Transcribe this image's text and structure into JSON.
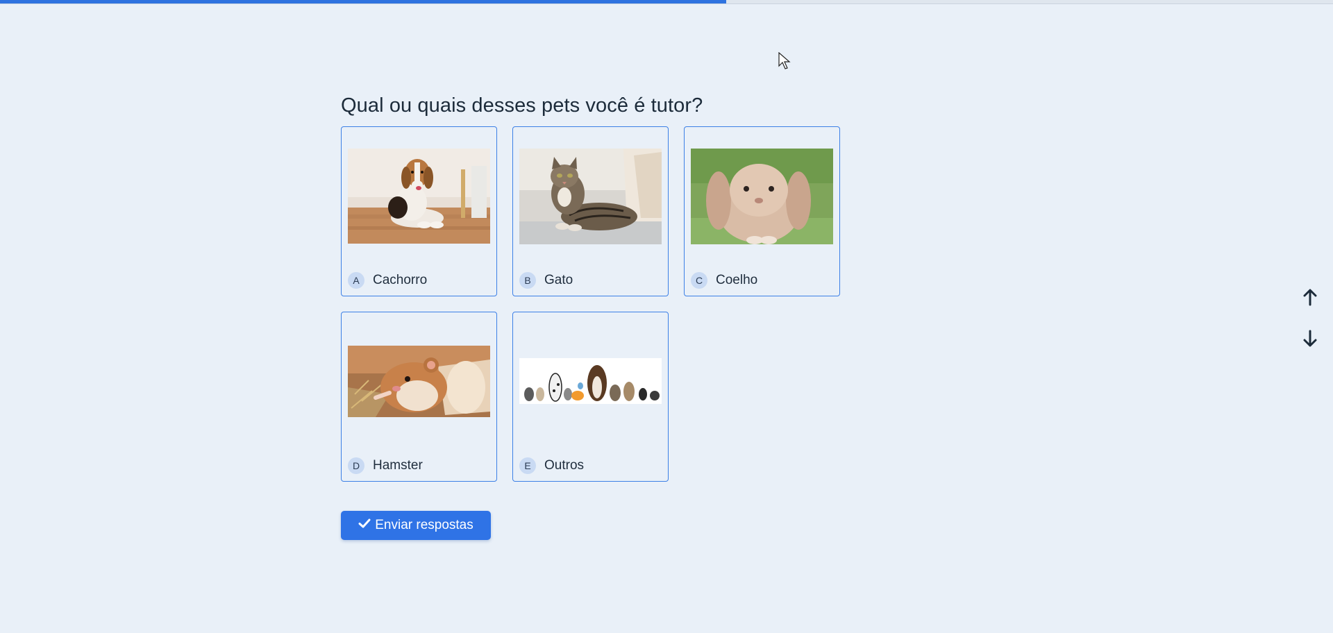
{
  "progress": {
    "fraction": 0.545
  },
  "question": {
    "title": "Qual ou quais desses pets você é tutor?"
  },
  "options": [
    {
      "key": "A",
      "label": "Cachorro",
      "icon": "dog-photo"
    },
    {
      "key": "B",
      "label": "Gato",
      "icon": "cat-photo"
    },
    {
      "key": "C",
      "label": "Coelho",
      "icon": "rabbit-photo"
    },
    {
      "key": "D",
      "label": "Hamster",
      "icon": "hamster-photo"
    },
    {
      "key": "E",
      "label": "Outros",
      "icon": "pets-group-photo"
    }
  ],
  "submit": {
    "label": "Enviar respostas",
    "icon": "check-icon"
  },
  "navigation": {
    "up_icon": "arrow-up-icon",
    "down_icon": "arrow-down-icon"
  },
  "colors": {
    "accent": "#2f73e6",
    "background": "#e9f0f8",
    "key_badge": "#c9daf3"
  }
}
